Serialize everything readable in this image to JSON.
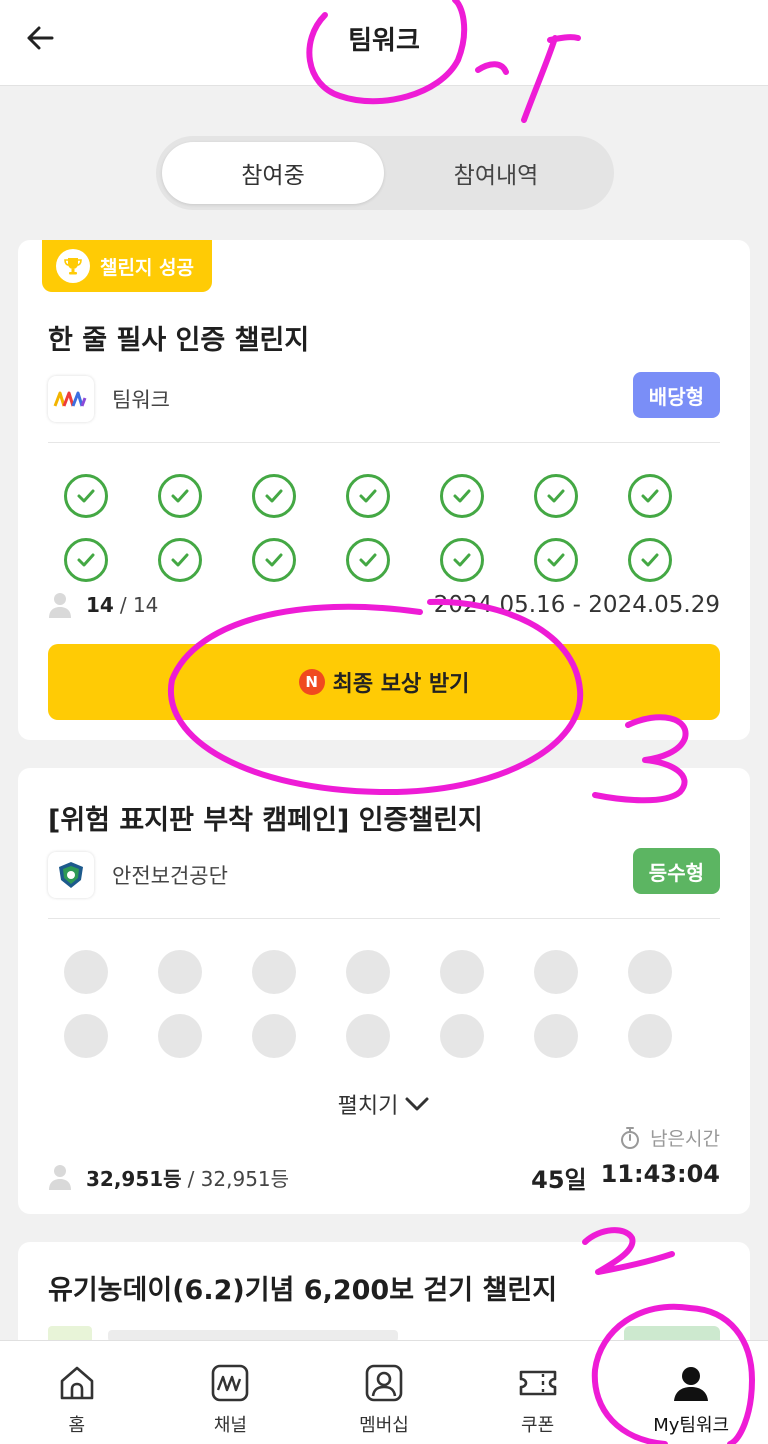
{
  "header": {
    "title": "팀워크"
  },
  "tabs": {
    "active": "참여중",
    "inactive": "참여내역"
  },
  "card1": {
    "badge": "챌린지 성공",
    "title": "한 줄 필사 인증 챌린지",
    "org": "팀워크",
    "type": "배당형",
    "checks_done": 14,
    "count_strong": "14",
    "count_rest": "/ 14",
    "date_range": "2024.05.16 - 2024.05.29",
    "reward_button": "최종 보상 받기",
    "reward_badge": "N"
  },
  "card2": {
    "title": "[위험 표지판 부착 캠페인] 인증챌린지",
    "org": "안전보건공단",
    "type": "등수형",
    "expand": "펼치기",
    "remain_label": "남은시간",
    "rank_strong": "32,951등",
    "rank_rest": "/ 32,951등",
    "days": "45일",
    "time": "11:43:04"
  },
  "card3": {
    "title": "유기농데이(6.2)기념 6,200보 걷기 챌린지"
  },
  "nav": [
    {
      "label": "홈",
      "icon": "home-icon"
    },
    {
      "label": "채널",
      "icon": "channel-icon"
    },
    {
      "label": "멤버십",
      "icon": "membership-icon"
    },
    {
      "label": "쿠폰",
      "icon": "coupon-icon"
    },
    {
      "label": "My팀워크",
      "icon": "my-teamwork-icon"
    }
  ],
  "annotations": {
    "color": "#ee1cd6",
    "marks": [
      "1",
      "2",
      "3"
    ]
  },
  "colors": {
    "accent_yellow": "#ffcb05",
    "check_green": "#44a844",
    "type_blue": "#7a8ef7",
    "type_green": "#5cb562"
  }
}
